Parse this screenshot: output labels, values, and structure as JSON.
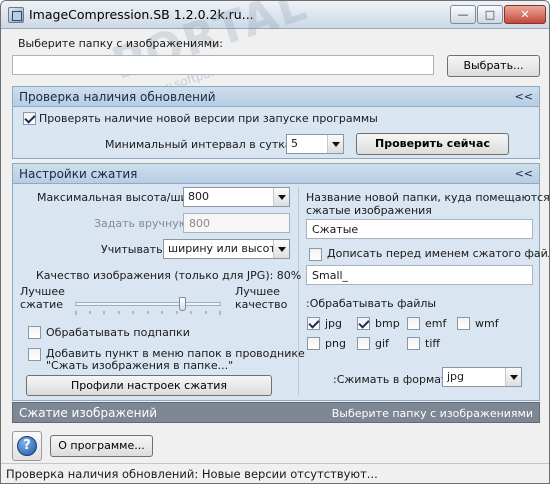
{
  "window": {
    "title": "ImageCompression.SB 1.2.0.2k.ru...",
    "minimize_glyph": "—",
    "maximize_glyph": "□",
    "close_glyph": "✕"
  },
  "folder": {
    "label": "Выберите папку с изображениями:",
    "value": "",
    "browse_label": "Выбрать..."
  },
  "updates_panel": {
    "title": "Проверка наличия обновлений",
    "collapse": "<<",
    "check_on_start_label": "Проверять наличие новой версии при запуске программы",
    "check_on_start_checked": true,
    "interval_label": "Минимальный интервал в сутках",
    "interval_value": "5",
    "check_now_label": "Проверить сейчас"
  },
  "compression_panel": {
    "title": "Настройки сжатия",
    "collapse": "<<",
    "max_size_label": "Максимальная высота/ширина",
    "max_size_value": "800",
    "manual_label": "Задать вручную",
    "manual_value": "800",
    "consider_label": "Учитывать",
    "consider_value": "ширину или высоту",
    "quality_label": "Качество изображения (только для JPG): 80%",
    "quality_value": 80,
    "best_compression_label_1": "Лучшее",
    "best_compression_label_2": "сжатие",
    "best_quality_label_1": "Лучшее",
    "best_quality_label_2": "качество",
    "subfolders_label": "Обрабатывать подпапки",
    "subfolders_checked": false,
    "context_menu_label_1": "Добавить пункт в меню папок в проводнике",
    "context_menu_label_2": "\"Сжать изображения в папке...\"",
    "context_menu_checked": false,
    "profiles_label": "Профили настроек сжатия",
    "new_folder_label_1": "Название новой папки, куда помещаются",
    "new_folder_label_2": "сжатые изображения",
    "new_folder_value": "Сжатые",
    "prefix_label": "Дописать перед именем сжатого файла:",
    "prefix_checked": false,
    "prefix_value": "Small_",
    "process_files_label": ":Обрабатывать файлы",
    "filetypes": [
      {
        "name": "jpg",
        "checked": true
      },
      {
        "name": "bmp",
        "checked": true
      },
      {
        "name": "emf",
        "checked": false
      },
      {
        "name": "wmf",
        "checked": false
      },
      {
        "name": "png",
        "checked": false
      },
      {
        "name": "gif",
        "checked": false
      },
      {
        "name": "tiff",
        "checked": false
      }
    ],
    "format_label": ":Сжимать в формат",
    "format_value": "jpg"
  },
  "compress_panel": {
    "title": "Сжатие изображений",
    "hint": "Выберите папку с изображениями"
  },
  "footer": {
    "help_glyph": "?",
    "about_label": "О программе..."
  },
  "status": {
    "text": "Проверка наличия обновлений: Новые версии отсутствуют..."
  },
  "watermark": {
    "text": "PORTAL",
    "sub": "www.softportal.com"
  }
}
